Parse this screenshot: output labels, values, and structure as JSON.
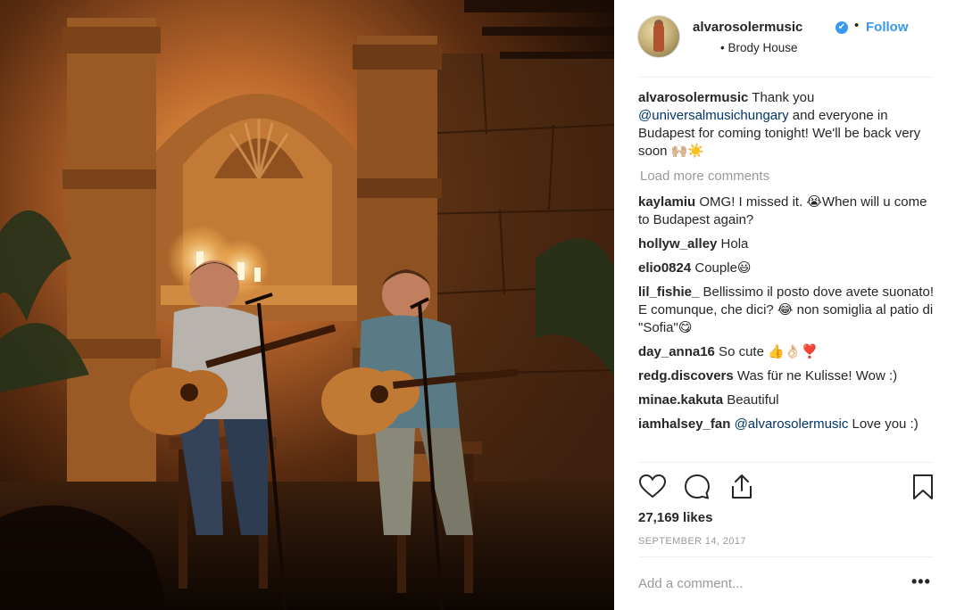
{
  "post": {
    "username": "alvarosolermusic",
    "verified_badge": "✔",
    "separator": "•",
    "follow_label": "Follow",
    "location_dot": "•",
    "location": "Brody House"
  },
  "caption": {
    "username": "alvarosolermusic",
    "text_1": " Thank you ",
    "mention": "@universalmusichungary",
    "text_2": " and everyone in Budapest for coming tonight! We'll be back very soon 🙌🏼☀️"
  },
  "load_more": "Load more comments",
  "comments": [
    {
      "user": "kaylamiu",
      "text": " OMG! I missed it. 😭When will u come to Budapest again?"
    },
    {
      "user": "hollyw_alley",
      "text": " Hola"
    },
    {
      "user": "elio0824",
      "text": " Couple😃"
    },
    {
      "user": "lil_fishie_",
      "text": "  Bellissimo il posto dove avete suonato! E comunque, che dici? 😂  non somiglia al patio di \"Sofia\"😋"
    },
    {
      "user": "day_anna16",
      "text": " So cute 👍👌🏻❣️"
    },
    {
      "user": "redg.discovers",
      "text": " Was für ne Kulisse! Wow :)"
    },
    {
      "user": "minae.kakuta",
      "text": " Beautiful"
    },
    {
      "user": "iamhalsey_fan",
      "text_pre": " ",
      "mention": "@alvarosolermusic",
      "text": " Love you :)"
    }
  ],
  "icons": {
    "like": "heart-icon",
    "comment": "comment-icon",
    "share": "share-icon",
    "save": "bookmark-icon",
    "more": "more-options-icon"
  },
  "likes": "27,169 likes",
  "date": "SEPTEMBER 14, 2017",
  "add_comment_placeholder": "Add a comment...",
  "more_label": "•••",
  "colors": {
    "accent": "#3897f0",
    "mention": "#003569",
    "muted": "#999999",
    "text": "#262626"
  }
}
